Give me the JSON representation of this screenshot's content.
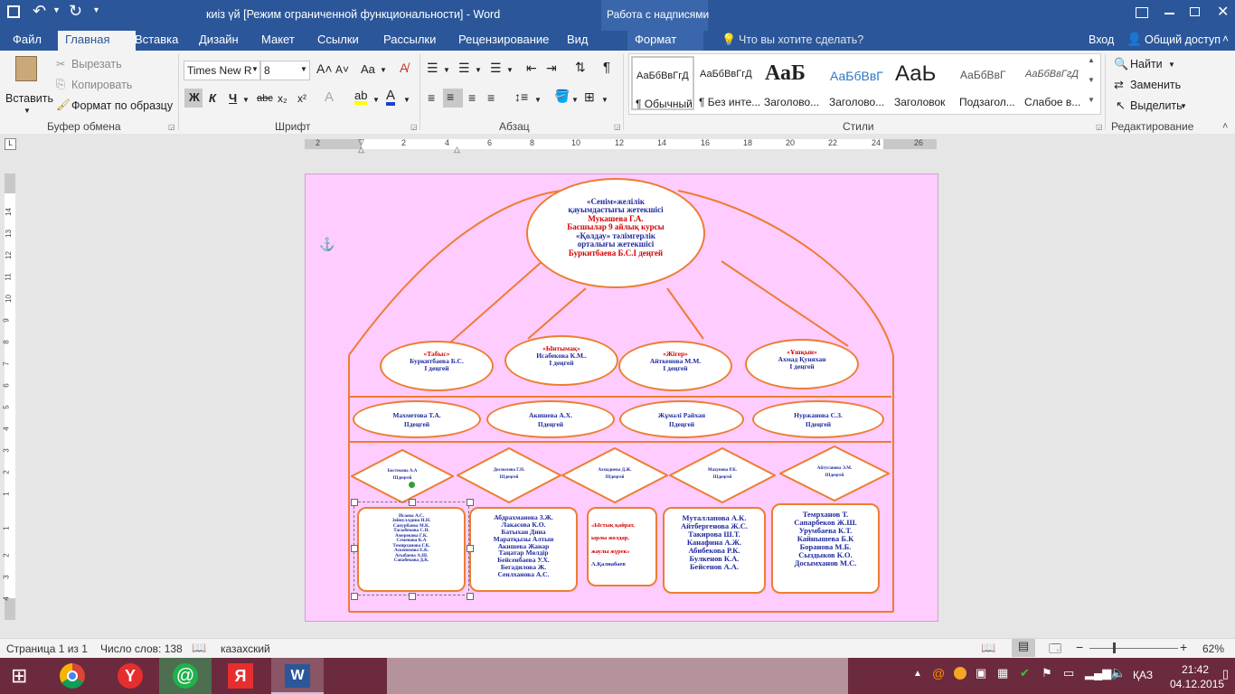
{
  "titlebar": {
    "title": "киіз үй [Режим ограниченной функциональности] - Word",
    "context_tab": "Работа с надписями"
  },
  "tabs": [
    "Файл",
    "Главная",
    "Вставка",
    "Дизайн",
    "Макет",
    "Ссылки",
    "Рассылки",
    "Рецензирование",
    "Вид",
    "Формат"
  ],
  "tellme": "Что вы хотите сделать?",
  "signin": "Вход",
  "share": "Общий доступ",
  "clipboard": {
    "paste": "Вставить",
    "cut": "Вырезать",
    "copy": "Копировать",
    "format_painter": "Формат по образцу",
    "label": "Буфер обмена"
  },
  "font": {
    "name": "Times New R",
    "size": "8",
    "bold": "Ж",
    "italic": "К",
    "underline": "Ч",
    "strike": "abc",
    "sub": "x₂",
    "sup": "x²",
    "case": "Aa",
    "label": "Шрифт"
  },
  "paragraph": {
    "label": "Абзац"
  },
  "styles": {
    "label": "Стили",
    "items": [
      {
        "preview": "АаБбВвГгД",
        "name": "¶ Обычный"
      },
      {
        "preview": "АаБбВвГгД",
        "name": "¶ Без инте..."
      },
      {
        "preview": "АаБ",
        "name": "Заголово..."
      },
      {
        "preview": "АаБбВвГ",
        "name": "Заголово..."
      },
      {
        "preview": "АаЬ",
        "name": "Заголовок"
      },
      {
        "preview": "АаБбВвГ",
        "name": "Подзагол..."
      },
      {
        "preview": "АаБбВвГгД",
        "name": "Слабое в..."
      }
    ]
  },
  "editing": {
    "find": "Найти",
    "replace": "Заменить",
    "select": "Выделить",
    "label": "Редактирование"
  },
  "ruler": {
    "h_ticks": [
      "2",
      "2",
      "4",
      "6",
      "8",
      "10",
      "12",
      "14",
      "16",
      "18",
      "20",
      "22",
      "24",
      "26"
    ],
    "v_ticks": [
      "14",
      "13",
      "12",
      "11",
      "10",
      "9",
      "8",
      "7",
      "6",
      "5",
      "4",
      "3",
      "2",
      "1",
      "1",
      "2",
      "3",
      "4"
    ]
  },
  "diagram": {
    "top": [
      {
        "t": "«Сенім»желілік",
        "c": "blue"
      },
      {
        "t": "қауымдастығы жетекшісі",
        "c": "blue"
      },
      {
        "t": "Мукашева Г.А.",
        "c": "red"
      },
      {
        "t": "Басшылар 9 айлық курсы",
        "c": "red"
      },
      {
        "t": "«Қолдау» тәлімгерлік",
        "c": "blue"
      },
      {
        "t": "орталығы жетекшісі",
        "c": "blue"
      },
      {
        "t": "Буркитбаева Б.С.І деңгей",
        "c": "red"
      }
    ],
    "row1": [
      {
        "title": "«Табыс»",
        "lines": [
          "Буркитбаева Б.С.",
          "І деңгей"
        ]
      },
      {
        "title": "«Ынтымақ»",
        "lines": [
          "Исабекова К.М..",
          "І деңгей"
        ]
      },
      {
        "title": "«Жігер»",
        "lines": [
          "Айткенова М.М.",
          "І деңгей"
        ]
      },
      {
        "title": "«Ұшқын»",
        "lines": [
          "Ахмад Қуняхан",
          "І деңгей"
        ]
      }
    ],
    "row2": [
      {
        "lines": [
          "Махметова Т.А.",
          "ІІдеңгей"
        ]
      },
      {
        "lines": [
          "Акишева А.Х.",
          "ІІдеңгей"
        ]
      },
      {
        "lines": [
          "Жұмәлі Райхан",
          "ІІдеңгей"
        ]
      },
      {
        "lines": [
          "Нуржанова С.З.",
          "ІІдеңгей"
        ]
      }
    ],
    "row3": [
      {
        "lines": [
          "Бостекова А.А",
          "ІІІдеңгей"
        ]
      },
      {
        "lines": [
          "Досмолова Г.Н.",
          "ІІІдеңгей"
        ]
      },
      {
        "lines": [
          "Ахмадиева Д.Ж.",
          "ІІІдеңгей"
        ]
      },
      {
        "lines": [
          "Махунова Р.К.",
          "ІІІдеңгей"
        ]
      },
      {
        "lines": [
          "Айтуганова Э.М.",
          "ІІІдеңгей"
        ]
      }
    ],
    "row4": [
      {
        "lines": [
          "Исаева А.С.",
          "Зейнуллдина Н.Н.",
          "Сапурбаева М.К.",
          "Тасыбекова С.Н.",
          "Амерекова Г.К.",
          "Семенова К.А",
          "Темирханова Г.К.",
          "Аскенизова Е.К.",
          "Агыбаева А.Ш.",
          "Сапабекова Д.К."
        ]
      },
      {
        "lines": [
          "Абдрахманова З.Ж.",
          "Лакасова К.О.",
          "Батыхан Дина",
          "Маратқызы Алтын",
          "Акишева Жанар",
          "Таңатар Мөлдір",
          "Бейсенбаева У.Х.",
          "Бегадилова Ж.",
          "Сеилханова А.С."
        ]
      },
      {
        "lines": [
          "«Ыстық қайрат,",
          "ырлы жолдар,",
          "жаулы жүрек»",
          "А.Қалиабаев"
        ]
      },
      {
        "lines": [
          "Муталлапова А.К.",
          "Айтбергенова Ж.С.",
          "Такирова Ш.Т.",
          "Канафина А.Ж.",
          "Абибекова Р.К.",
          "Булкенов К.А.",
          "Бейсенов А.А."
        ]
      },
      {
        "lines": [
          "Темрханов Т.",
          "Сапарбеков Ж.Ш.",
          "Урумбаева К.Т.",
          "Кайнышева Б.К",
          "Боранова М.Б.",
          "Сыздыков К.О.",
          "Досымханов М.С."
        ]
      }
    ]
  },
  "status": {
    "page": "Страница 1 из 1",
    "words": "Число слов: 138",
    "lang": "казахский",
    "zoom": "62%"
  },
  "taskbar": {
    "lang": "ҚАЗ",
    "time": "21:42",
    "date": "04.12.2015"
  },
  "colors": {
    "word_blue": "#2b579a",
    "page_bg": "#ffccff",
    "shape_border": "#ed7d31",
    "text_blue": "#1f2a9e",
    "text_red": "#d40000"
  }
}
